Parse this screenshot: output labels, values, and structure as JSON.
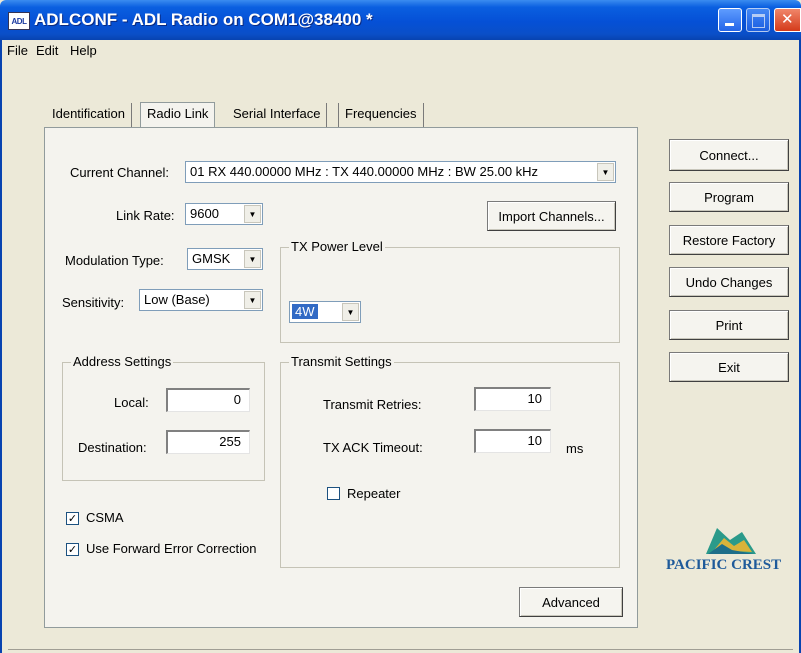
{
  "window": {
    "icon_text": "ADL",
    "title": "ADLCONF - ADL Radio on COM1@38400 *"
  },
  "menu": {
    "file": "File",
    "edit": "Edit",
    "help": "Help"
  },
  "tabs": [
    {
      "label": "Identification",
      "active": false
    },
    {
      "label": "Radio Link",
      "active": true
    },
    {
      "label": "Serial Interface",
      "active": false
    },
    {
      "label": "Frequencies",
      "active": false
    }
  ],
  "radio_link": {
    "current_channel_label": "Current Channel:",
    "current_channel_value": "01  RX 440.00000 MHz : TX 440.00000 MHz : BW 25.00 kHz",
    "link_rate_label": "Link Rate:",
    "link_rate_value": "9600",
    "import_channels_label": "Import Channels...",
    "modulation_label": "Modulation Type:",
    "modulation_value": "GMSK",
    "sensitivity_label": "Sensitivity:",
    "sensitivity_value": "Low (Base)",
    "tx_power_group": "TX Power Level",
    "tx_power_value": "4W",
    "address_group": "Address Settings",
    "local_label": "Local:",
    "local_value": "0",
    "destination_label": "Destination:",
    "destination_value": "255",
    "transmit_group": "Transmit Settings",
    "retries_label": "Transmit Retries:",
    "retries_value": "10",
    "ack_timeout_label": "TX ACK Timeout:",
    "ack_timeout_value": "10",
    "ack_timeout_unit": "ms",
    "repeater_label": "Repeater",
    "repeater_checked": false,
    "csma_label": "CSMA",
    "csma_checked": true,
    "fec_label": "Use Forward Error Correction",
    "fec_checked": true,
    "advanced_label": "Advanced"
  },
  "side_buttons": {
    "connect": "Connect...",
    "program": "Program",
    "restore": "Restore Factory",
    "undo": "Undo Changes",
    "print": "Print",
    "exit": "Exit"
  },
  "logo": {
    "text": "PACIFIC CREST",
    "colors": {
      "teal": "#2a9a8a",
      "gold": "#d9b33a",
      "blue": "#1e5a9a"
    }
  }
}
